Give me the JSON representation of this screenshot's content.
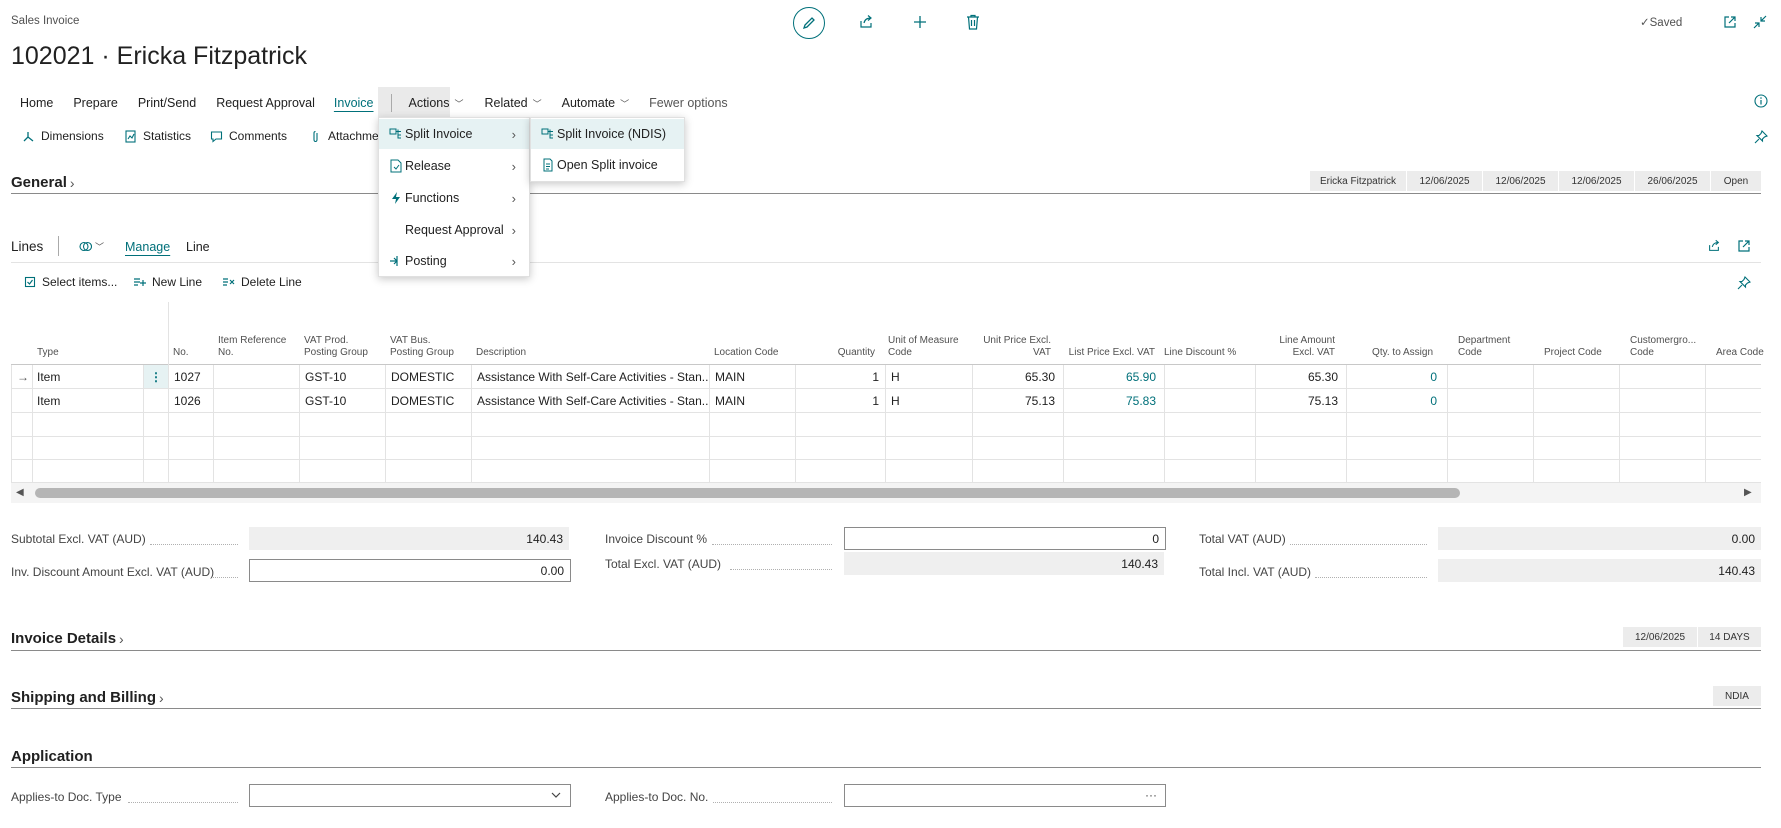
{
  "header": {
    "doc_type": "Sales Invoice",
    "title": "102021 · Ericka Fitzpatrick",
    "saved_label": "Saved"
  },
  "nav": {
    "items": [
      "Home",
      "Prepare",
      "Print/Send",
      "Request Approval",
      "Invoice",
      "Actions",
      "Related",
      "Automate",
      "Fewer options"
    ],
    "active": "Invoice"
  },
  "promoted": [
    "Dimensions",
    "Statistics",
    "Comments",
    "Attachments"
  ],
  "actions_menu": {
    "items": [
      "Split Invoice",
      "Release",
      "Functions",
      "Request Approval",
      "Posting"
    ],
    "submenu": [
      "Split Invoice (NDIS)",
      "Open Split invoice"
    ]
  },
  "general": {
    "title": "General",
    "chips": [
      "Ericka Fitzpatrick",
      "12/06/2025",
      "12/06/2025",
      "12/06/2025",
      "26/06/2025",
      "Open"
    ]
  },
  "lines": {
    "title": "Lines",
    "tabs": [
      "Manage",
      "Line"
    ],
    "toolbar": [
      "Select items...",
      "New Line",
      "Delete Line"
    ],
    "columns": [
      "Type",
      "No.",
      "Item Reference No.",
      "VAT Prod. Posting Group",
      "VAT Bus. Posting Group",
      "Description",
      "Location Code",
      "Quantity",
      "Unit of Measure Code",
      "Unit Price Excl. VAT",
      "List Price Excl. VAT",
      "Line Discount %",
      "Line Amount Excl. VAT",
      "Qty. to Assign",
      "Department Code",
      "Project Code",
      "Customergro... Code",
      "Area Code"
    ],
    "rows": [
      {
        "type": "Item",
        "no": "1027",
        "item_ref": "",
        "vat_prod": "GST-10",
        "vat_bus": "DOMESTIC",
        "description": "Assistance With Self-Care Activities - Stan...",
        "location": "MAIN",
        "quantity": "1",
        "uom": "H",
        "unit_price": "65.30",
        "list_price": "65.90",
        "line_discount": "",
        "line_amount": "65.30",
        "qty_assign": "0"
      },
      {
        "type": "Item",
        "no": "1026",
        "item_ref": "",
        "vat_prod": "GST-10",
        "vat_bus": "DOMESTIC",
        "description": "Assistance With Self-Care Activities - Stan...",
        "location": "MAIN",
        "quantity": "1",
        "uom": "H",
        "unit_price": "75.13",
        "list_price": "75.83",
        "line_discount": "",
        "line_amount": "75.13",
        "qty_assign": "0"
      }
    ]
  },
  "totals": {
    "subtotal_label": "Subtotal Excl. VAT (AUD)",
    "subtotal": "140.43",
    "inv_disc_amount_label": "Inv. Discount Amount Excl. VAT (AUD)",
    "inv_disc_amount": "0.00",
    "invoice_discount_pct_label": "Invoice Discount %",
    "invoice_discount_pct": "0",
    "total_excl_label": "Total Excl. VAT (AUD)",
    "total_excl": "140.43",
    "total_vat_label": "Total VAT (AUD)",
    "total_vat": "0.00",
    "total_incl_label": "Total Incl. VAT (AUD)",
    "total_incl": "140.43"
  },
  "invoice_details": {
    "title": "Invoice Details",
    "chips": [
      "12/06/2025",
      "14 DAYS"
    ]
  },
  "shipping": {
    "title": "Shipping and Billing",
    "chips": [
      "NDIA"
    ]
  },
  "application": {
    "title": "Application",
    "doc_type_label": "Applies-to Doc. Type",
    "doc_type_value": "",
    "doc_no_label": "Applies-to Doc. No.",
    "doc_no_value": ""
  },
  "colors": {
    "accent": "#00707a",
    "menu_hover": "#e6f2f3",
    "readonly_field": "#efefef"
  }
}
